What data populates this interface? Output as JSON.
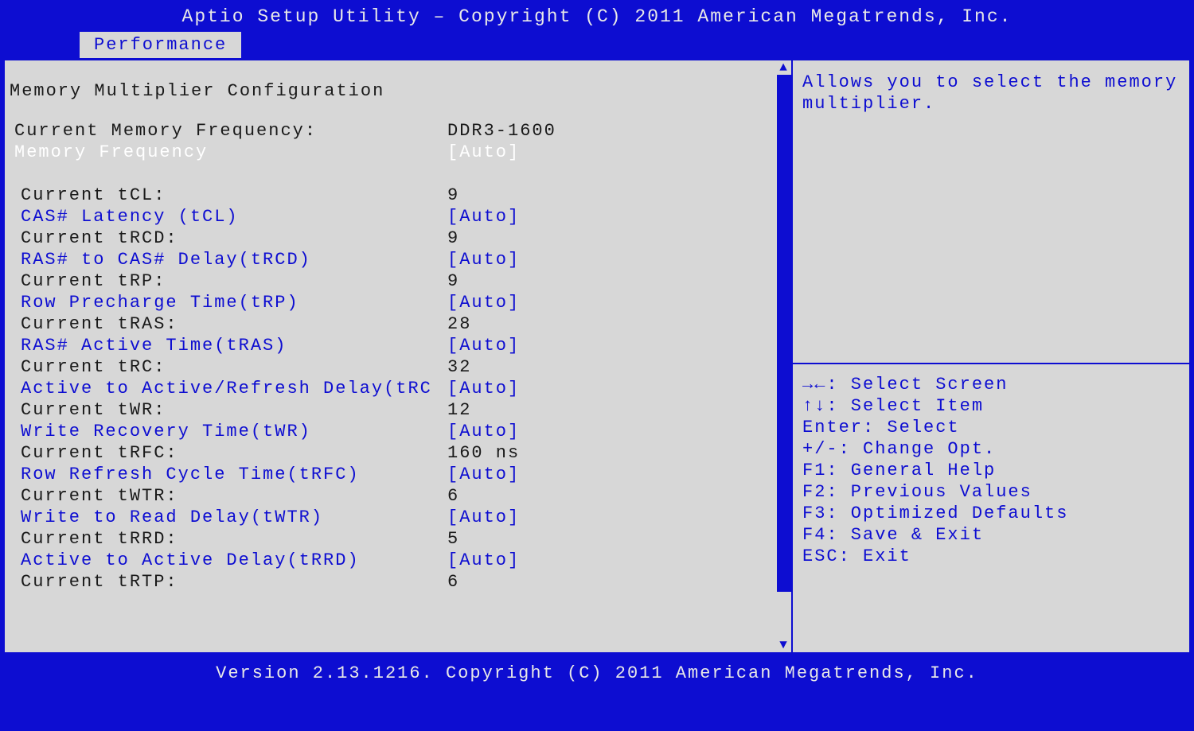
{
  "header": "Aptio Setup Utility – Copyright (C) 2011 American Megatrends, Inc.",
  "tab": "Performance",
  "section_title": "Memory Multiplier Configuration",
  "rows": [
    {
      "label": "Current Memory Frequency:",
      "value": "DDR3-1600",
      "cls": "static"
    },
    {
      "label": "Memory Frequency",
      "value": "[Auto]",
      "cls": "selected"
    },
    {
      "gap": true
    },
    {
      "label": "Current tCL:",
      "value": "9",
      "cls": "static",
      "indent": true
    },
    {
      "label": "CAS# Latency (tCL)",
      "value": "[Auto]",
      "cls": "option",
      "indent": true
    },
    {
      "label": "Current tRCD:",
      "value": "9",
      "cls": "static",
      "indent": true
    },
    {
      "label": "RAS# to CAS# Delay(tRCD)",
      "value": "[Auto]",
      "cls": "option",
      "indent": true
    },
    {
      "label": "Current tRP:",
      "value": "9",
      "cls": "static",
      "indent": true
    },
    {
      "label": "Row Precharge Time(tRP)",
      "value": "[Auto]",
      "cls": "option",
      "indent": true
    },
    {
      "label": "Current tRAS:",
      "value": "28",
      "cls": "static",
      "indent": true
    },
    {
      "label": "RAS# Active Time(tRAS)",
      "value": "[Auto]",
      "cls": "option",
      "indent": true
    },
    {
      "label": "Current tRC:",
      "value": "32",
      "cls": "static",
      "indent": true
    },
    {
      "label": "Active to Active/Refresh Delay(tRC",
      "value": "[Auto]",
      "cls": "option",
      "indent": true
    },
    {
      "label": "Current tWR:",
      "value": "12",
      "cls": "static",
      "indent": true
    },
    {
      "label": "Write Recovery Time(tWR)",
      "value": "[Auto]",
      "cls": "option",
      "indent": true
    },
    {
      "label": "Current tRFC:",
      "value": "160 ns",
      "cls": "static",
      "indent": true
    },
    {
      "label": "Row Refresh Cycle Time(tRFC)",
      "value": "[Auto]",
      "cls": "option",
      "indent": true
    },
    {
      "label": "Current tWTR:",
      "value": "6",
      "cls": "static",
      "indent": true
    },
    {
      "label": "Write to Read Delay(tWTR)",
      "value": "[Auto]",
      "cls": "option",
      "indent": true
    },
    {
      "label": "Current tRRD:",
      "value": "5",
      "cls": "static",
      "indent": true
    },
    {
      "label": "Active to Active Delay(tRRD)",
      "value": "[Auto]",
      "cls": "option",
      "indent": true
    },
    {
      "label": "Current tRTP:",
      "value": "6",
      "cls": "static",
      "indent": true
    }
  ],
  "help_text": "Allows you to select the memory multiplier.",
  "legend": [
    "→←: Select Screen",
    "↑↓: Select Item",
    "Enter: Select",
    "+/-: Change Opt.",
    "F1: General Help",
    "F2: Previous Values",
    "F3: Optimized Defaults",
    "F4: Save & Exit",
    "ESC: Exit"
  ],
  "footer": "Version 2.13.1216. Copyright (C) 2011 American Megatrends, Inc."
}
